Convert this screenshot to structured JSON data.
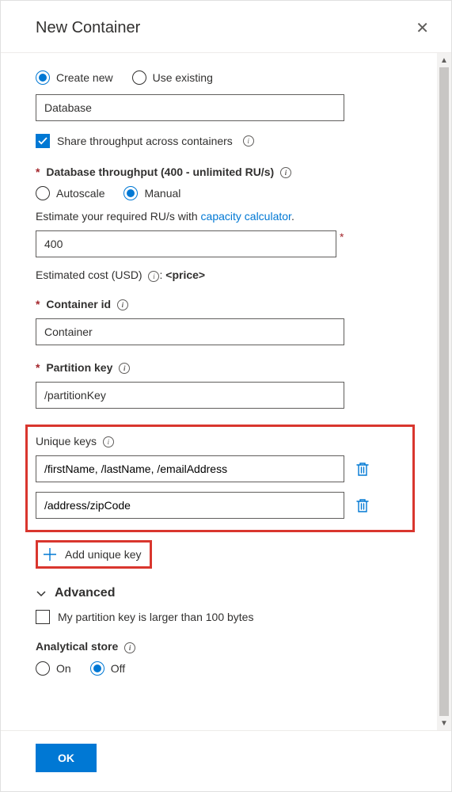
{
  "header": {
    "title": "New Container"
  },
  "db_mode": {
    "create_new": "Create new",
    "use_existing": "Use existing",
    "selected": "create_new"
  },
  "database_name": "Database",
  "share_throughput": {
    "label": "Share throughput across containers",
    "checked": true
  },
  "throughput_section": {
    "label": "Database throughput (400 - unlimited RU/s)",
    "mode": {
      "autoscale": "Autoscale",
      "manual": "Manual",
      "selected": "manual"
    },
    "helper_prefix": "Estimate your required RU/s with ",
    "helper_link": "capacity calculator",
    "helper_suffix": ".",
    "value": "400",
    "estimated_label": "Estimated cost (USD) ",
    "estimated_value": "<price>"
  },
  "container_id": {
    "label": "Container id",
    "value": "Container"
  },
  "partition_key": {
    "label": "Partition key",
    "value": "/partitionKey"
  },
  "unique_keys": {
    "label": "Unique keys",
    "rows": [
      "/firstName, /lastName, /emailAddress",
      "/address/zipCode"
    ],
    "add_label": "Add unique key"
  },
  "advanced": {
    "label": "Advanced",
    "large_partition_label": "My partition key is larger than 100 bytes"
  },
  "analytical": {
    "label": "Analytical store",
    "on": "On",
    "off": "Off",
    "selected": "off"
  },
  "footer": {
    "ok": "OK"
  }
}
